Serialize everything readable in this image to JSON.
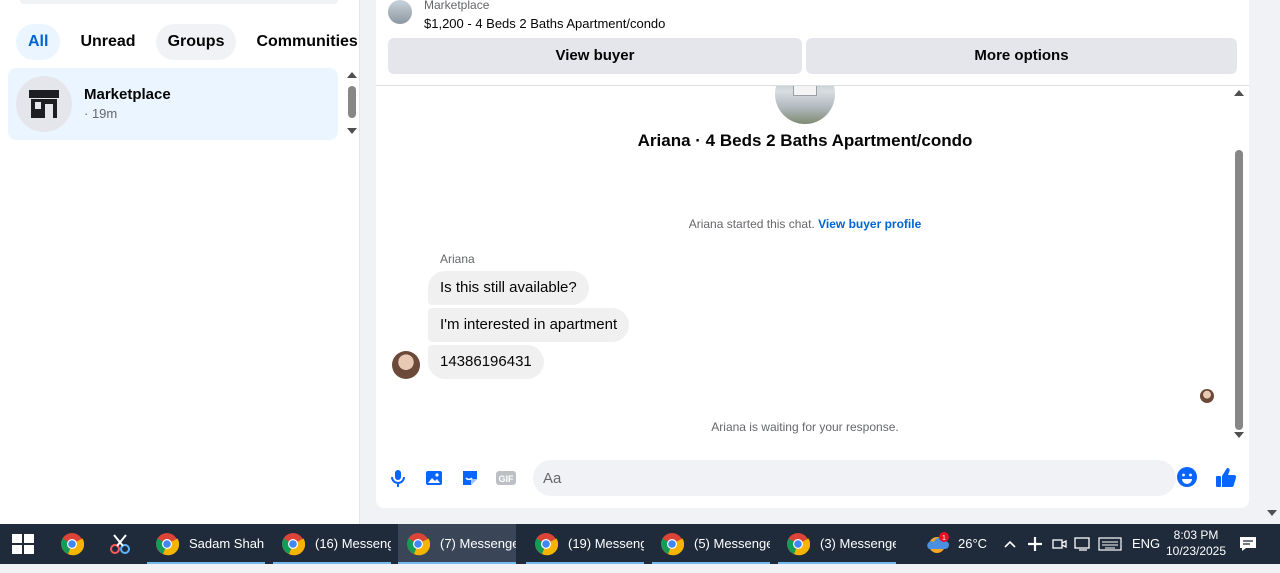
{
  "left_panel": {
    "filters": [
      {
        "label": "All",
        "active": true
      },
      {
        "label": "Unread",
        "active": false
      },
      {
        "label": "Groups",
        "active": false
      },
      {
        "label": "Communities",
        "active": false
      }
    ],
    "conversations": [
      {
        "name": "Marketplace",
        "time": "· 19m",
        "icon": "storefront-icon"
      }
    ]
  },
  "chat": {
    "listing": {
      "category": "Marketplace",
      "title": "$1,200 - 4 Beds 2 Baths Apartment/condo"
    },
    "buttons": {
      "view_buyer": "View buyer",
      "more_options": "More options"
    },
    "banner_title": "Ariana · 4 Beds 2 Baths Apartment/condo",
    "started_text": "Ariana started this chat.",
    "started_link": "View buyer profile",
    "sender_name": "Ariana",
    "messages": [
      "Is this still available?",
      "I'm interested in apartment",
      "14386196431"
    ],
    "waiting_text": "Ariana is waiting for your response.",
    "composer": {
      "placeholder": "Aa",
      "icons": [
        "microphone-icon",
        "image-icon",
        "sticker-icon",
        "gif-icon",
        "emoji-icon",
        "thumbs-up-icon"
      ]
    }
  },
  "colors": {
    "accent": "#0064d1",
    "messenger_blue": "#0866ff",
    "taskbar": "#1f2a3a"
  },
  "taskbar": {
    "pinned": [
      "chrome-icon",
      "snipping-tool-icon"
    ],
    "tasks": [
      {
        "label": "Sadam Shah ...",
        "active": false
      },
      {
        "label": "(16) Messeng...",
        "active": false
      },
      {
        "label": "(7) Messenge...",
        "active": true
      },
      {
        "label": "(19) Messeng...",
        "active": false
      },
      {
        "label": "(5) Messenge...",
        "active": false
      },
      {
        "label": "(3) Messenge...",
        "active": false
      }
    ],
    "weather": {
      "temp": "26°C",
      "badge": "1"
    },
    "language": "ENG",
    "time": "8:03 PM",
    "date": "10/23/2025"
  }
}
